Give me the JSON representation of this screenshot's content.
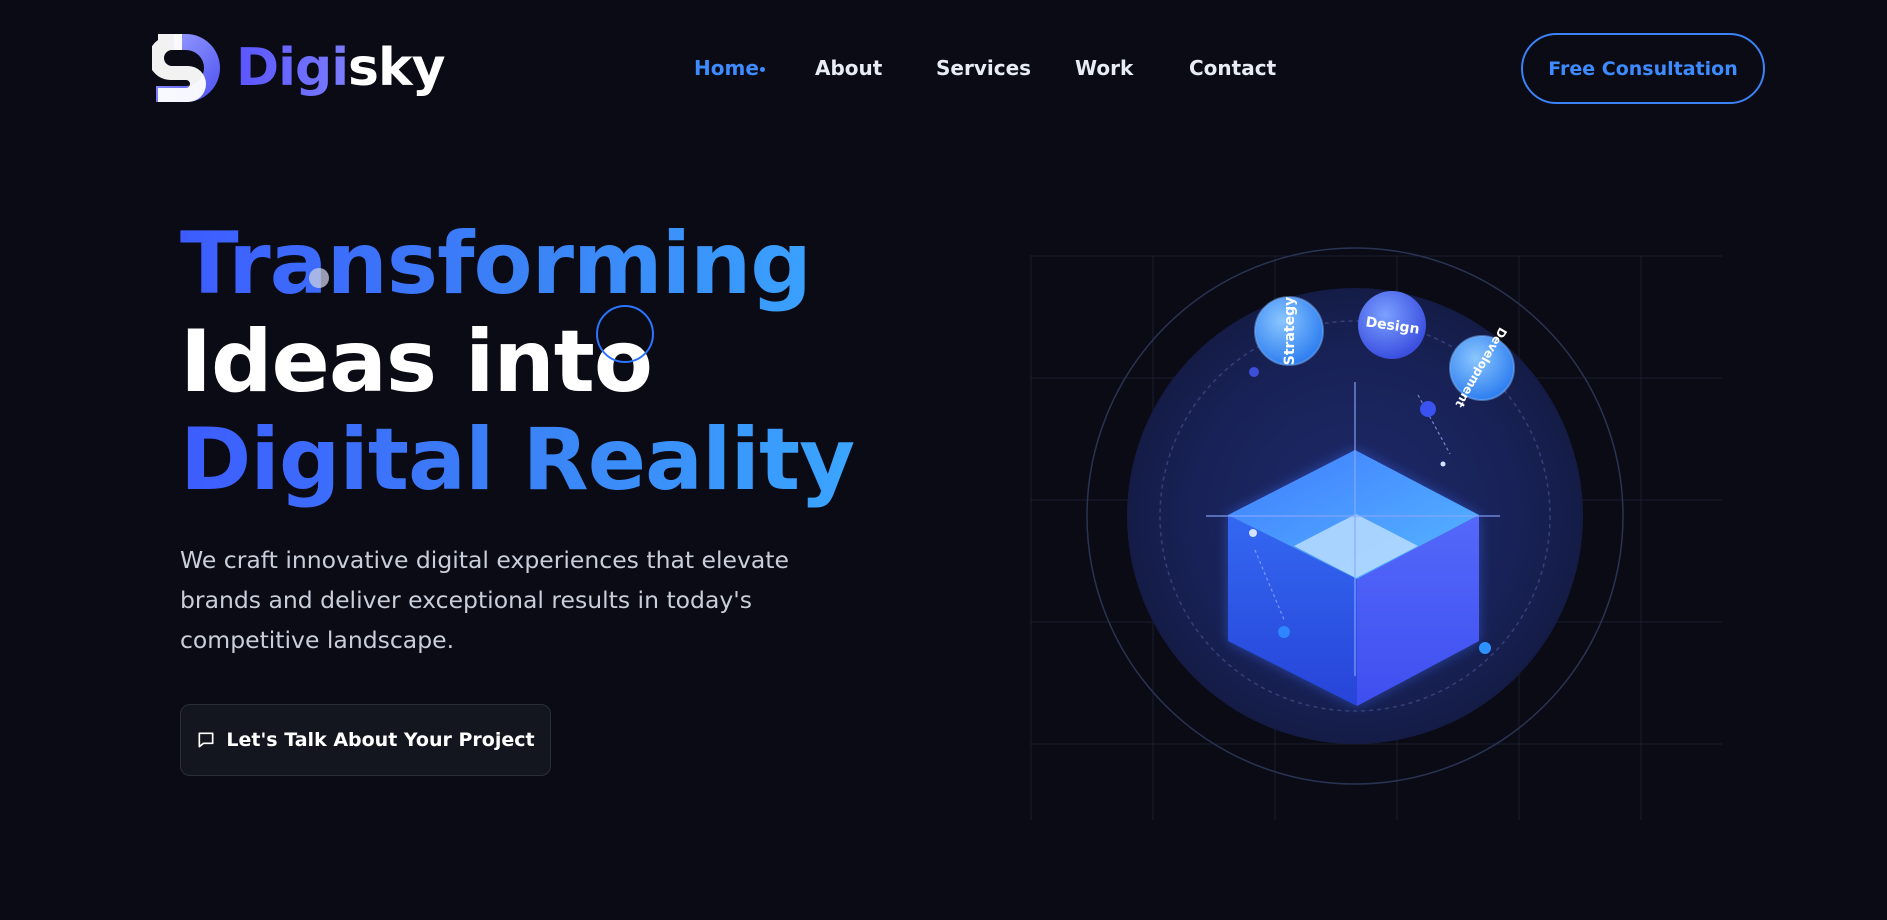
{
  "brand": {
    "name_part1": "Digi",
    "name_part2": "sky",
    "accent_color": "#3d8bff",
    "logo_icon": "logo-mark-icon"
  },
  "nav": {
    "items": [
      {
        "label": "Home",
        "active": true
      },
      {
        "label": "About",
        "active": false
      },
      {
        "label": "Services",
        "active": false
      },
      {
        "label": "Work",
        "active": false
      },
      {
        "label": "Contact",
        "active": false
      }
    ],
    "cta": "Free Consultation"
  },
  "hero": {
    "headline_line1": "Transforming",
    "headline_line2": "Ideas into",
    "headline_line3": "Digital Reality",
    "subtext": "We craft innovative digital experiences that elevate brands and deliver exceptional results in today's competitive landscape.",
    "cta_label": "Let's Talk About Your Project",
    "cta_icon": "chat-bubble-icon"
  },
  "illustration": {
    "orbs": [
      "Strategy",
      "Design",
      "Development"
    ],
    "colors": {
      "background": "#0a0b14",
      "cube_top": "#4ea2ff",
      "cube_left": "#2f56e8",
      "cube_right": "#4a5df5",
      "circle": "#151d47"
    }
  }
}
